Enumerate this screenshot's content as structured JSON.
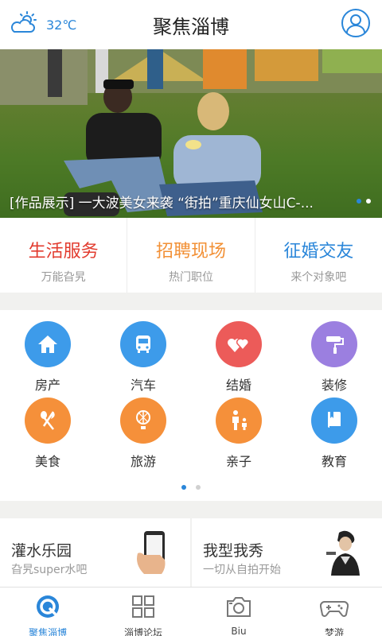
{
  "header": {
    "weather": {
      "icon": "cloudy-sun-icon",
      "temperature": "32℃"
    },
    "title": "聚焦淄博",
    "user_icon": "user-avatar-icon"
  },
  "banner": {
    "caption": "[作品展示] 一大波美女来袭 “街拍”重庆仙女山C-...",
    "slide_count": 2,
    "active_slide": 1
  },
  "services": [
    {
      "title": "生活服务",
      "subtitle": "万能旮旯",
      "color": "#e23b2e"
    },
    {
      "title": "招聘现场",
      "subtitle": "热门职位",
      "color": "#f29035"
    },
    {
      "title": "征婚交友",
      "subtitle": "来个对象吧",
      "color": "#2a86d9"
    }
  ],
  "categories": [
    {
      "label": "房产",
      "icon": "house-icon",
      "color": "#3d9bea"
    },
    {
      "label": "汽车",
      "icon": "bus-icon",
      "color": "#3d9bea"
    },
    {
      "label": "结婚",
      "icon": "hearts-icon",
      "color": "#ec5b59"
    },
    {
      "label": "装修",
      "icon": "paint-roller-icon",
      "color": "#9b7fe0"
    },
    {
      "label": "美食",
      "icon": "spoon-knife-icon",
      "color": "#f5903a"
    },
    {
      "label": "旅游",
      "icon": "hot-air-balloon-icon",
      "color": "#f5903a"
    },
    {
      "label": "亲子",
      "icon": "parent-child-icon",
      "color": "#f5903a"
    },
    {
      "label": "教育",
      "icon": "book-icon",
      "color": "#3d9bea"
    }
  ],
  "category_pages": {
    "count": 2,
    "active": 1
  },
  "features": [
    {
      "title": "灌水乐园",
      "subtitle": "旮旯super水吧",
      "art": "smartphone-in-hand-illustration"
    },
    {
      "title": "我型我秀",
      "subtitle": "一切从自拍开始",
      "art": "selfie-person-illustration"
    }
  ],
  "tabs": [
    {
      "label": "聚焦淄博",
      "icon": "logo-q-icon",
      "active": true
    },
    {
      "label": "淄博论坛",
      "icon": "grid-icon",
      "active": false
    },
    {
      "label": "Biu",
      "icon": "camera-icon",
      "active": false
    },
    {
      "label": "梦游",
      "icon": "gamepad-icon",
      "active": false
    }
  ],
  "colors": {
    "accent": "#2a86d9",
    "separator": "#f1f1ef"
  }
}
